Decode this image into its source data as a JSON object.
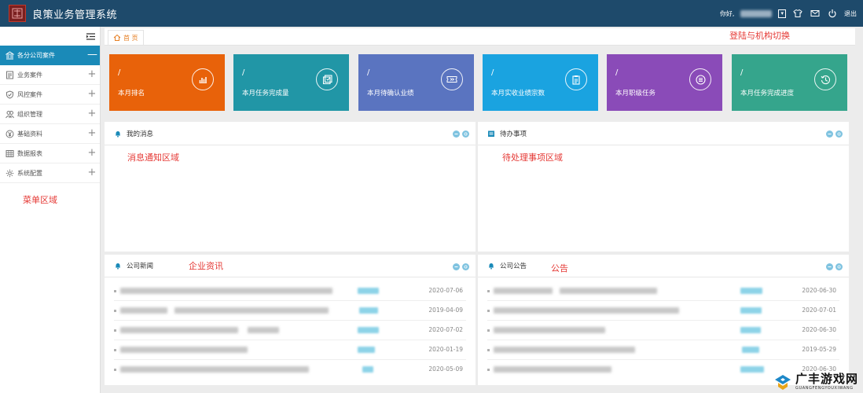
{
  "header": {
    "app_title": "良策业务管理系统",
    "greeting": "你好,",
    "caret": "▾",
    "logout_label": "退出"
  },
  "sidebar": {
    "items": [
      {
        "label": "各分公司案件",
        "toggle": "—",
        "icon": "bank-icon"
      },
      {
        "label": "业务案件",
        "toggle": "+",
        "icon": "document-icon"
      },
      {
        "label": "风控案件",
        "toggle": "+",
        "icon": "shield-icon"
      },
      {
        "label": "组织管理",
        "toggle": "+",
        "icon": "users-icon"
      },
      {
        "label": "基础资料",
        "toggle": "+",
        "icon": "yen-icon"
      },
      {
        "label": "数据报表",
        "toggle": "+",
        "icon": "table-icon"
      },
      {
        "label": "系统配置",
        "toggle": "+",
        "icon": "gear-icon"
      }
    ]
  },
  "tabs": {
    "home_label": "首 页"
  },
  "annotations": {
    "login_switch": "登陆与机构切换",
    "menu_area": "菜单区域",
    "message_area": "消息通知区域",
    "todo_area": "待处理事项区域",
    "enterprise_news": "企业资讯",
    "announcement": "公告"
  },
  "cards": [
    {
      "value": "/",
      "label": "本月排名",
      "color": "#e8620a",
      "icon": "bar-chart-icon"
    },
    {
      "value": "/",
      "label": "本月任务完成量",
      "color": "#2196a6",
      "icon": "checkbox-icon"
    },
    {
      "value": "/",
      "label": "本月待确认业绩",
      "color": "#5a74c0",
      "icon": "ticket-icon"
    },
    {
      "value": "/",
      "label": "本月实收业绩宗数",
      "color": "#1aa3e0",
      "icon": "clipboard-icon"
    },
    {
      "value": "/",
      "label": "本月职级任务",
      "color": "#8a4bb8",
      "icon": "list-circle-icon"
    },
    {
      "value": "/",
      "label": "本月任务完成进度",
      "color": "#35a58c",
      "icon": "clock-icon"
    }
  ],
  "panels": {
    "messages": {
      "title": "我的消息"
    },
    "todo": {
      "title": "待办事项"
    },
    "news": {
      "title": "公司新闻",
      "dates": [
        "2020-07-06",
        "2019-04-09",
        "2020-07-02",
        "2020-01-19",
        "2020-05-09"
      ]
    },
    "notices": {
      "title": "公司公告",
      "dates": [
        "2020-06-30",
        "2020-07-01",
        "2020-06-30",
        "2019-05-29",
        "2020-06-30"
      ]
    }
  },
  "watermark": {
    "main": "广丰游戏网",
    "sub": "GUANGFENGYOUXIWANG"
  }
}
